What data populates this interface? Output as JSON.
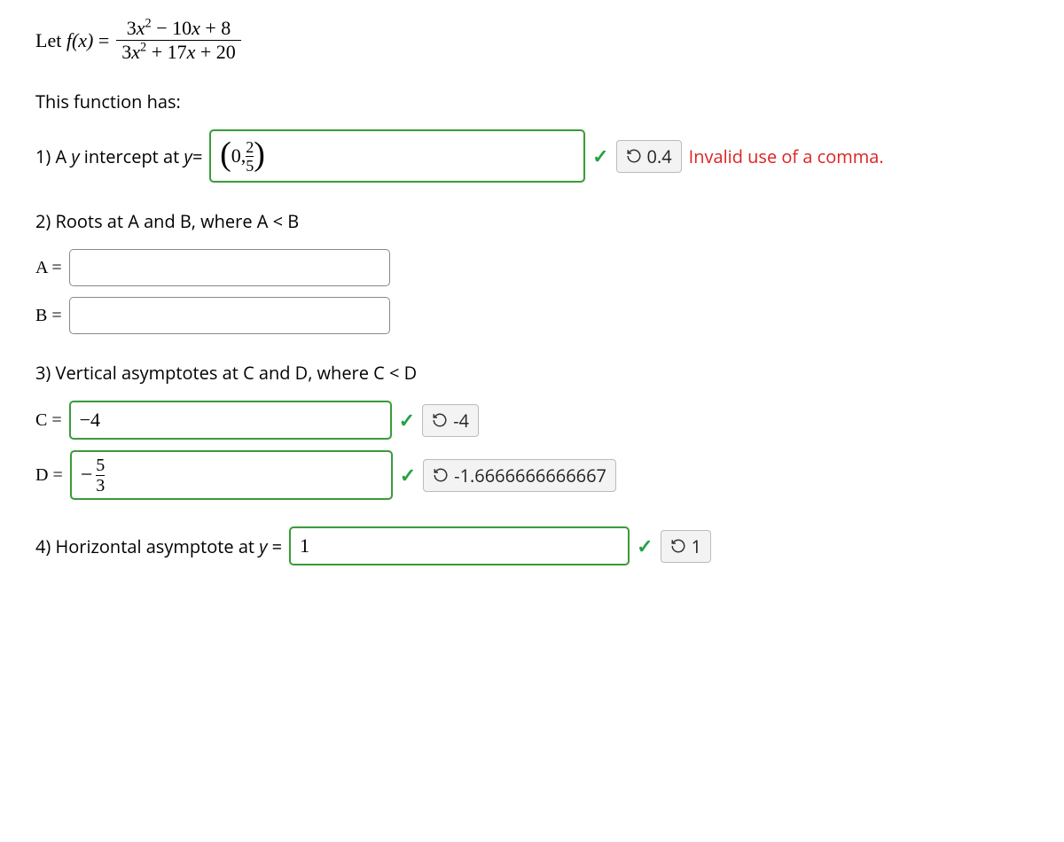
{
  "formula": {
    "lead": "Let ",
    "fx": "f(x)",
    "eq": " = ",
    "num": "3x² − 10x + 8",
    "den": "3x² + 17x + 20"
  },
  "intro": "This function has:",
  "q1": {
    "label_pre": "1) A ",
    "label_var": "y",
    "label_post": " intercept at ",
    "label_eq": "y=",
    "input_display": "(0, 2/5)",
    "paren_open": "(",
    "zero": "0",
    "comma": ", ",
    "frac_num": "2",
    "frac_den": "5",
    "paren_close": ")",
    "correct": true,
    "badge": "0.4",
    "error": "Invalid use of a comma."
  },
  "q2": {
    "label": "2) Roots at A and B, where A < B",
    "A_label": "A =",
    "A_value": "",
    "B_label": "B =",
    "B_value": ""
  },
  "q3": {
    "label": "3) Vertical asymptotes at C and D, where C < D",
    "C_label": "C =",
    "C_value": "−4",
    "C_correct": true,
    "C_badge": "-4",
    "D_label": "D =",
    "D_neg": "−",
    "D_frac_num": "5",
    "D_frac_den": "3",
    "D_correct": true,
    "D_badge": "-1.6666666666667"
  },
  "q4": {
    "label_pre": "4) Horizontal asymptote at ",
    "label_var": "y",
    "label_eq": " = ",
    "value": "1",
    "correct": true,
    "badge": "1"
  }
}
